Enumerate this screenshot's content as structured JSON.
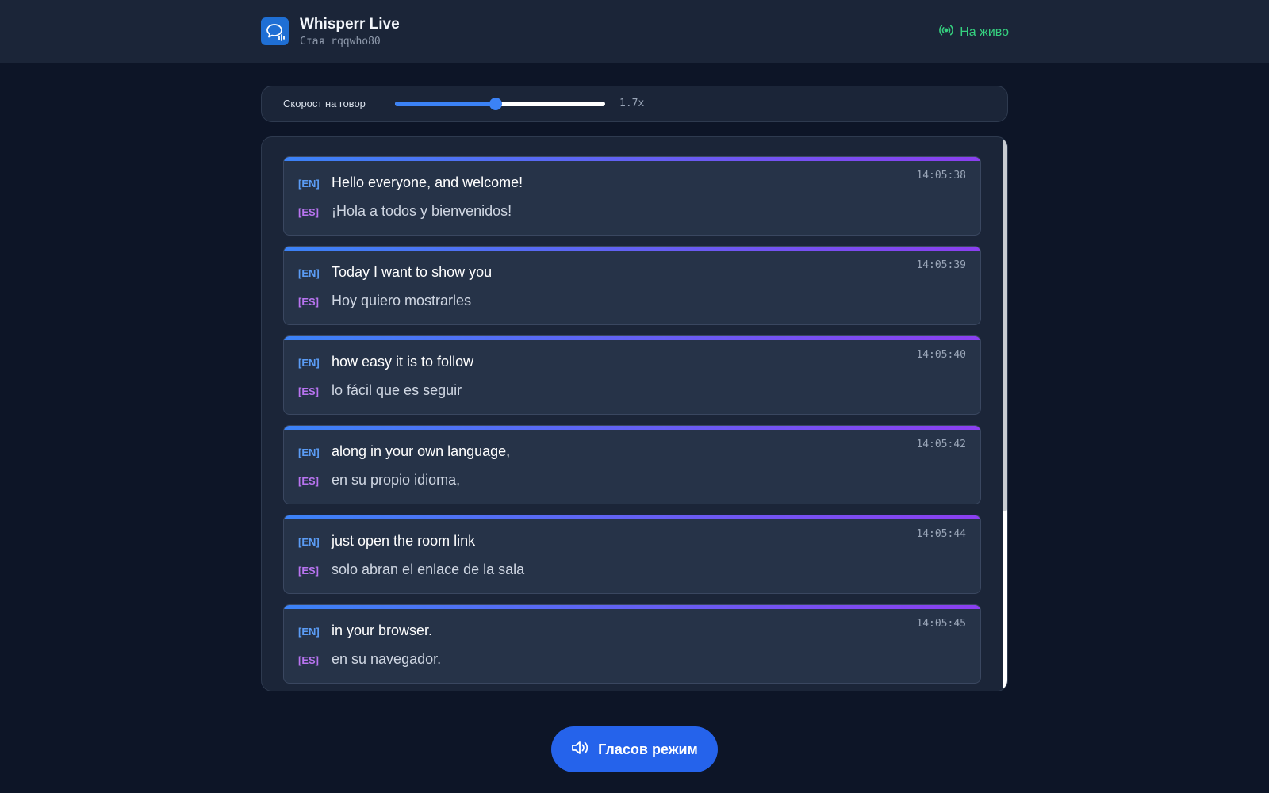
{
  "header": {
    "title": "Whisperr Live",
    "room_id": "Стая rqqwho80",
    "live_status": "На живо",
    "logo_icon": "chat-bubble-waveform-icon",
    "live_icon": "broadcast-icon"
  },
  "speed": {
    "label": "Скорост на говор",
    "value_text": "1.7x",
    "slider_level": 0.48
  },
  "languages": {
    "source_tag": "[EN]",
    "target_tag": "[ES]"
  },
  "transcript": {
    "entries": [
      {
        "time": "14:05:38",
        "en": "Hello everyone, and welcome!",
        "es": "¡Hola a todos y bienvenidos!"
      },
      {
        "time": "14:05:39",
        "en": "Today I want to show you",
        "es": "Hoy quiero mostrarles"
      },
      {
        "time": "14:05:40",
        "en": "how easy it is to follow",
        "es": "lo fácil que es seguir"
      },
      {
        "time": "14:05:42",
        "en": "along in your own language,",
        "es": "en su propio idioma,"
      },
      {
        "time": "14:05:44",
        "en": "just open the room link",
        "es": "solo abran el enlace de la sala"
      },
      {
        "time": "14:05:45",
        "en": "in your browser.",
        "es": "en su navegador."
      }
    ]
  },
  "voice_button": {
    "label": "Гласов режим",
    "icon": "speaker-icon"
  },
  "colors": {
    "background": "#0d1527",
    "panel": "#1b2538",
    "accent_blue": "#3b82f6",
    "accent_purple": "#8b3ff0",
    "live_green": "#35d07f",
    "button": "#2563eb"
  }
}
